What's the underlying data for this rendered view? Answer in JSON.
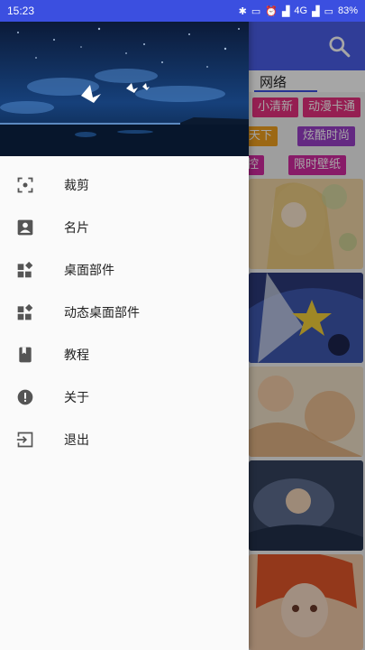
{
  "status_bar": {
    "time": "15:23",
    "network_label": "4G",
    "battery_percent": "83%"
  },
  "drawer": {
    "menu_items": [
      {
        "label": "裁剪",
        "icon": "crop-icon"
      },
      {
        "label": "名片",
        "icon": "contact-card-icon"
      },
      {
        "label": "桌面部件",
        "icon": "widgets-icon"
      },
      {
        "label": "动态桌面部件",
        "icon": "widgets-icon"
      },
      {
        "label": "教程",
        "icon": "book-icon"
      },
      {
        "label": "关于",
        "icon": "info-icon"
      },
      {
        "label": "退出",
        "icon": "exit-icon"
      }
    ]
  },
  "background_app": {
    "active_tab": "网络",
    "tags": [
      "小清新",
      "动漫卡通",
      "天下",
      "炫酷时尚",
      "控",
      "限时壁纸"
    ],
    "colors": {
      "toolbar": "#4a5fe8",
      "status_bar": "#3b4fe0",
      "tag_pink": "#e5317e",
      "tag_orange": "#f0a020",
      "tag_purple": "#9a40c8",
      "tag_magenta": "#d22aa0"
    }
  }
}
